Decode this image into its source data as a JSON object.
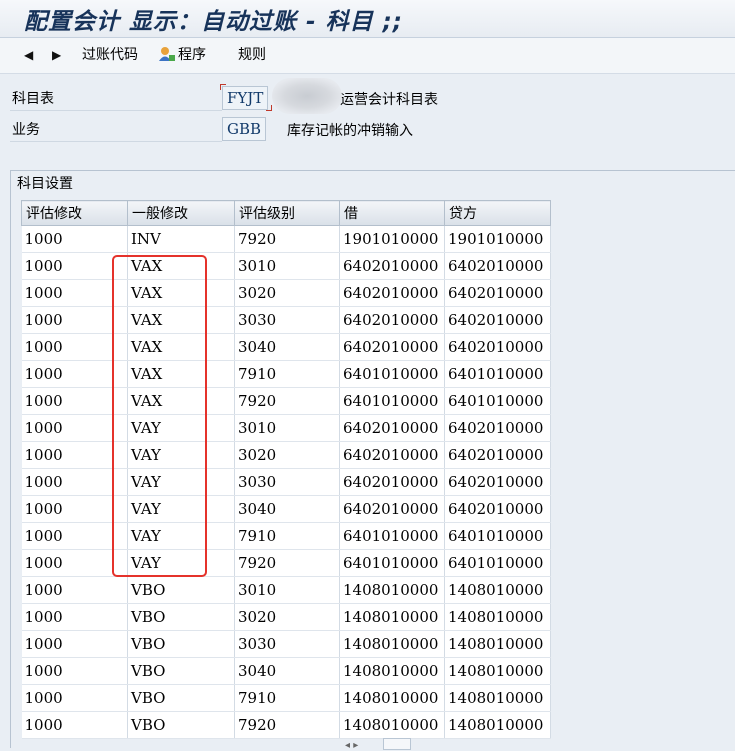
{
  "window": {
    "title": "配置会计 显示：自动过账 - 科目 ;;"
  },
  "toolbar": {
    "back_icon": "◀",
    "forward_icon": "▶",
    "posting_code_label": "过账代码",
    "program_label": "程序",
    "rules_label": "规则"
  },
  "form": {
    "chart_label": "科目表",
    "chart_value": "FYJT",
    "chart_desc": "运营会计科目表",
    "transaction_label": "业务",
    "transaction_value": "GBB",
    "transaction_desc": "库存记帐的冲销输入"
  },
  "group": {
    "title": "科目设置",
    "columns": [
      "评估修改",
      "一般修改",
      "评估级别",
      "借",
      "贷方"
    ],
    "rows": [
      [
        "1000",
        "INV",
        "7920",
        "1901010000",
        "1901010000"
      ],
      [
        "1000",
        "VAX",
        "3010",
        "6402010000",
        "6402010000"
      ],
      [
        "1000",
        "VAX",
        "3020",
        "6402010000",
        "6402010000"
      ],
      [
        "1000",
        "VAX",
        "3030",
        "6402010000",
        "6402010000"
      ],
      [
        "1000",
        "VAX",
        "3040",
        "6402010000",
        "6402010000"
      ],
      [
        "1000",
        "VAX",
        "7910",
        "6401010000",
        "6401010000"
      ],
      [
        "1000",
        "VAX",
        "7920",
        "6401010000",
        "6401010000"
      ],
      [
        "1000",
        "VAY",
        "3010",
        "6402010000",
        "6402010000"
      ],
      [
        "1000",
        "VAY",
        "3020",
        "6402010000",
        "6402010000"
      ],
      [
        "1000",
        "VAY",
        "3030",
        "6402010000",
        "6402010000"
      ],
      [
        "1000",
        "VAY",
        "3040",
        "6402010000",
        "6402010000"
      ],
      [
        "1000",
        "VAY",
        "7910",
        "6401010000",
        "6401010000"
      ],
      [
        "1000",
        "VAY",
        "7920",
        "6401010000",
        "6401010000"
      ],
      [
        "1000",
        "VBO",
        "3010",
        "1408010000",
        "1408010000"
      ],
      [
        "1000",
        "VBO",
        "3020",
        "1408010000",
        "1408010000"
      ],
      [
        "1000",
        "VBO",
        "3030",
        "1408010000",
        "1408010000"
      ],
      [
        "1000",
        "VBO",
        "3040",
        "1408010000",
        "1408010000"
      ],
      [
        "1000",
        "VBO",
        "7910",
        "1408010000",
        "1408010000"
      ],
      [
        "1000",
        "VBO",
        "7920",
        "1408010000",
        "1408010000"
      ]
    ]
  },
  "colors": {
    "highlight": "#e5322b",
    "title_text": "#17335a"
  }
}
